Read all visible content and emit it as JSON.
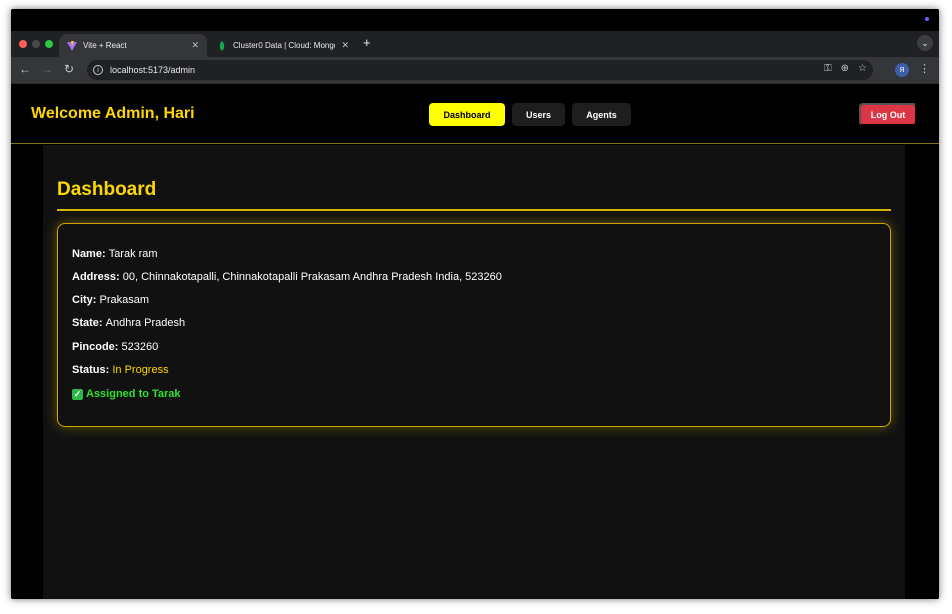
{
  "browser": {
    "tabs": [
      {
        "title": "Vite + React",
        "active": true,
        "favicon": "vite-icon"
      },
      {
        "title": "Cluster0 Data | Cloud: Mongo",
        "active": false,
        "favicon": "mongodb-leaf-icon"
      }
    ],
    "url": "localhost:5173/admin",
    "profile_initial": "Я"
  },
  "header": {
    "welcome": "Welcome Admin, Hari",
    "nav": {
      "dashboard": "Dashboard",
      "users": "Users",
      "agents": "Agents"
    },
    "logout": "Log Out"
  },
  "main": {
    "title": "Dashboard",
    "card": {
      "fields": [
        {
          "label": "Name:",
          "value": "Tarak ram"
        },
        {
          "label": "Address:",
          "value": "00, Chinnakotapalli, Chinnakotapalli Prakasam Andhra Pradesh India, 523260"
        },
        {
          "label": "City:",
          "value": "Prakasam"
        },
        {
          "label": "State:",
          "value": "Andhra Pradesh"
        },
        {
          "label": "Pincode:",
          "value": "523260"
        }
      ],
      "status_label": "Status:",
      "status_value": "In Progress",
      "assigned": "Assigned to Tarak"
    }
  },
  "colors": {
    "accent": "#ffd700",
    "active_nav": "#ffff00",
    "logout": "#dc3545",
    "assigned": "#32e032"
  }
}
